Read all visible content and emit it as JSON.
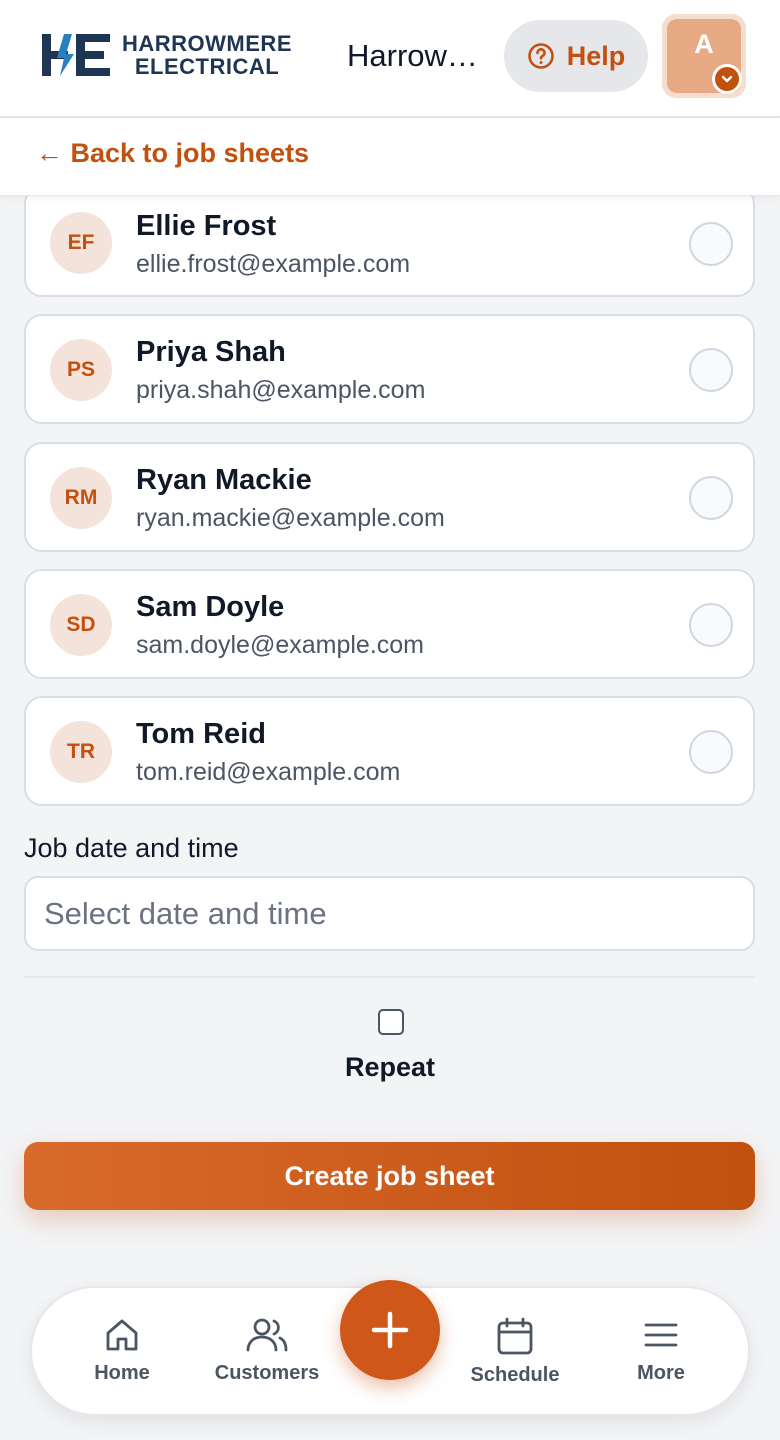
{
  "header": {
    "logo_line1": "HARROWMERE",
    "logo_line2": "ELECTRICAL",
    "company_name": "Harrowmere Electrical",
    "help_label": "Help",
    "avatar_initial": "A"
  },
  "back_link": "← Back to job sheets",
  "members": [
    {
      "initials": "EF",
      "name": "Ellie Frost",
      "email": "ellie.frost@example.com",
      "selected": false
    },
    {
      "initials": "PS",
      "name": "Priya Shah",
      "email": "priya.shah@example.com",
      "selected": false
    },
    {
      "initials": "RM",
      "name": "Ryan Mackie",
      "email": "ryan.mackie@example.com",
      "selected": false
    },
    {
      "initials": "SD",
      "name": "Sam Doyle",
      "email": "sam.doyle@example.com",
      "selected": false
    },
    {
      "initials": "TR",
      "name": "Tom Reid",
      "email": "tom.reid@example.com",
      "selected": false
    }
  ],
  "job_date": {
    "label": "Job date and time",
    "placeholder": "Select date and time",
    "value": ""
  },
  "repeat": {
    "label": "Repeat",
    "checked": false
  },
  "create_button": "Create job sheet",
  "bottom_nav": {
    "home": "Home",
    "customers": "Customers",
    "schedule": "Schedule",
    "more": "More"
  },
  "colors": {
    "accent": "#c2500e",
    "brand_navy": "#1f3554",
    "background": "#f3f4f6"
  }
}
